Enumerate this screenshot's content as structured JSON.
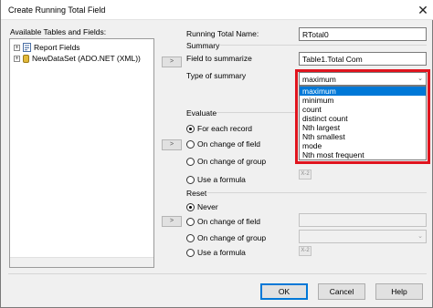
{
  "window": {
    "title": "Create Running Total Field",
    "close_glyph": "✕"
  },
  "tree": {
    "label": "Available Tables and Fields:",
    "items": [
      {
        "label": "Report Fields",
        "icon": "report-fields-icon"
      },
      {
        "label": "NewDataSet (ADO.NET (XML))",
        "icon": "database-icon"
      }
    ]
  },
  "form": {
    "name_label": "Running Total Name:",
    "name_value": "RTotal0",
    "summary_header": "Summary",
    "field_to_summarize_label": "Field to summarize",
    "field_to_summarize_value": "Table1.Total Com",
    "type_of_summary_label": "Type of summary",
    "type_of_summary_value": "maximum",
    "type_options": [
      "maximum",
      "minimum",
      "count",
      "distinct count",
      "Nth largest",
      "Nth smallest",
      "mode",
      "Nth most frequent"
    ],
    "selected_option": "maximum"
  },
  "evaluate": {
    "header": "Evaluate",
    "options": [
      "For each record",
      "On change of field",
      "On change of group",
      "Use a formula"
    ],
    "selected": "For each record"
  },
  "reset": {
    "header": "Reset",
    "options": [
      "Never",
      "On change of field",
      "On change of group",
      "Use a formula"
    ],
    "selected": "Never"
  },
  "transfer_arrow": ">",
  "formula_icon_text": "X-2",
  "buttons": {
    "ok": "OK",
    "cancel": "Cancel",
    "help": "Help"
  },
  "colors": {
    "highlight_border": "#e0141e",
    "selection": "#0078d7"
  }
}
